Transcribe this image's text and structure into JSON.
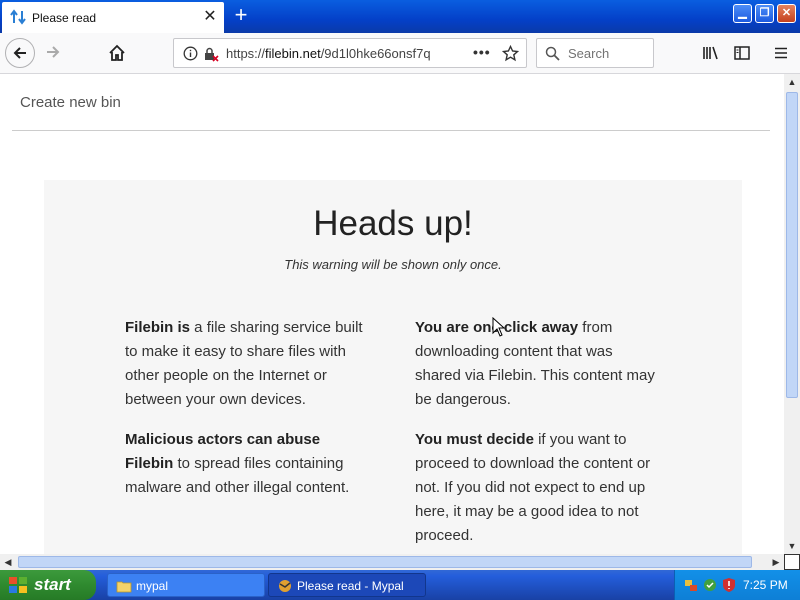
{
  "tab": {
    "title": "Please read",
    "close_glyph": "✕"
  },
  "newtab_glyph": "+",
  "window_buttons": {
    "minimize": "▁",
    "restore": "❐",
    "close": "✕"
  },
  "nav": {
    "url_prefix": "https://",
    "url_domain": "filebin.net",
    "url_path": "/9d1l0hke66onsf7q",
    "search_placeholder": "Search"
  },
  "page": {
    "create_bin": "Create new bin",
    "heading": "Heads up!",
    "subtitle": "This warning will be shown only once.",
    "col1": [
      {
        "bold": "Filebin is",
        "text": " a file sharing service built to make it easy to share files with other people on the Internet or between your own devices."
      },
      {
        "bold": "Malicious actors can abuse Filebin",
        "text": " to spread files containing malware and other illegal content."
      }
    ],
    "col2": [
      {
        "bold": "You are one click away",
        "text": " from downloading content that was shared via Filebin. This content may be dangerous."
      },
      {
        "bold": "You must decide",
        "text": " if you want to proceed to download the content or not. If you did not expect to end up here, it may be a good idea to not proceed."
      }
    ]
  },
  "taskbar": {
    "start": "start",
    "items": [
      {
        "label": "mypal"
      },
      {
        "label": "Please read - Mypal"
      }
    ],
    "clock": "7:25 PM"
  },
  "colors": {
    "taskbar": "#245edb",
    "start": "#2f8a2f",
    "titlebar": "#0a5ee0"
  }
}
